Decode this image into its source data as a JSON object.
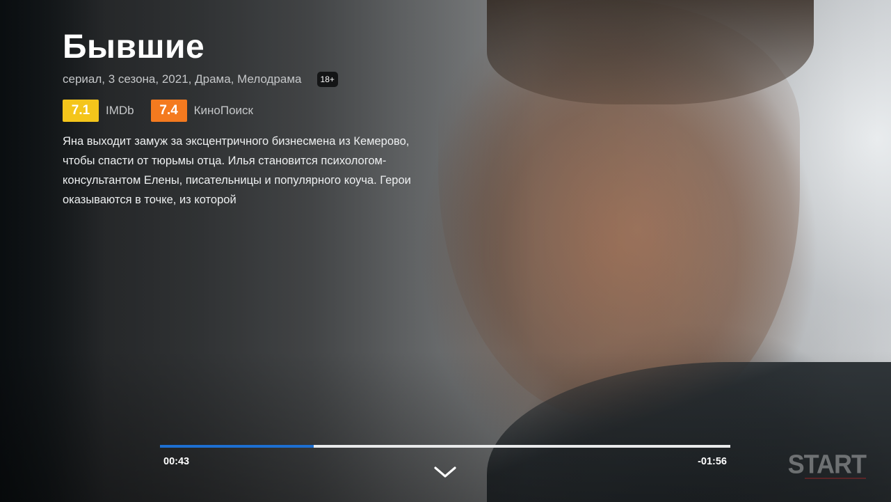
{
  "show": {
    "title": "Бывшие",
    "meta": "сериал, 3 сезона, 2021, Драма, Мелодрама",
    "age_rating": "18+",
    "ratings": [
      {
        "score": "7.1",
        "source": "IMDb",
        "color": "#f4c51b"
      },
      {
        "score": "7.4",
        "source": "КиноПоиск",
        "color": "#f47a1f"
      }
    ],
    "description": "Яна выходит замуж за эксцентричного бизнесмена из Кемерово, чтобы спасти от тюрьмы отца. Илья становится психологом-консультантом Елены, писательницы и популярного коуча. Герои оказываются в точке, из которой"
  },
  "player": {
    "elapsed": "00:43",
    "remaining": "-01:56",
    "progress_fraction": 0.27,
    "accent_color": "#1d6fd1"
  },
  "icons": {
    "expand": "chevron-down-icon"
  },
  "branding": {
    "logo_text": "START"
  }
}
